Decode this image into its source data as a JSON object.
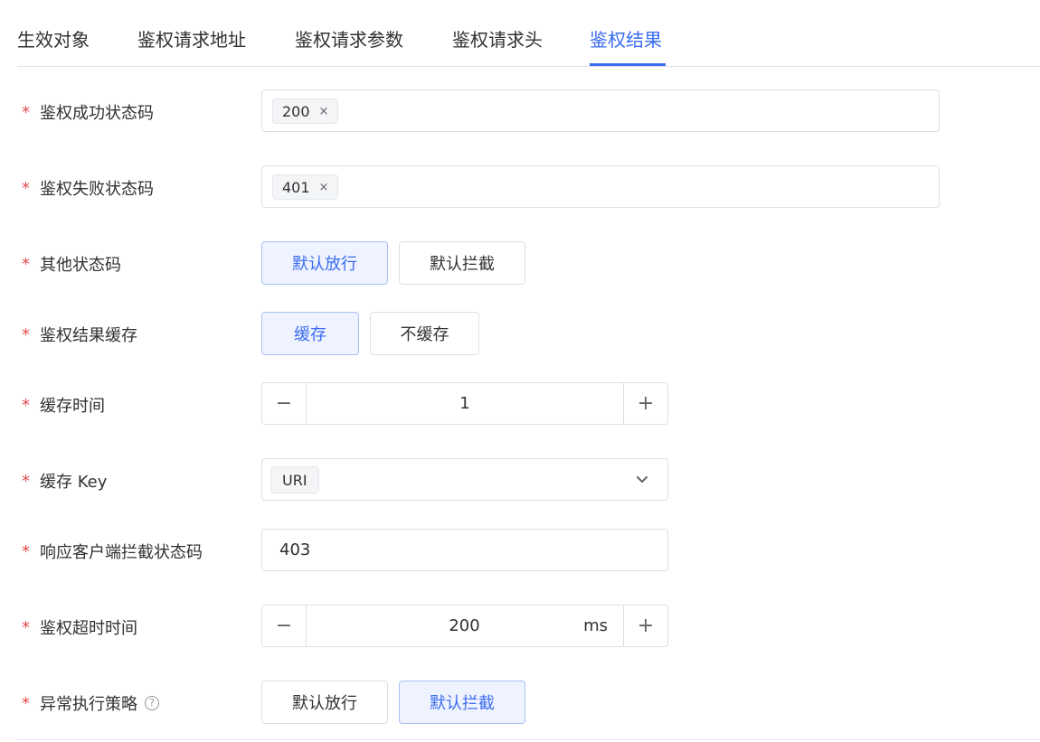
{
  "tabs": [
    {
      "label": "生效对象",
      "active": false
    },
    {
      "label": "鉴权请求地址",
      "active": false
    },
    {
      "label": "鉴权请求参数",
      "active": false
    },
    {
      "label": "鉴权请求头",
      "active": false
    },
    {
      "label": "鉴权结果",
      "active": true
    }
  ],
  "form": {
    "required_mark": "*",
    "success_codes": {
      "label": "鉴权成功状态码",
      "tags": [
        "200"
      ],
      "remove_icon": "close-icon",
      "remove_glyph": "×"
    },
    "fail_codes": {
      "label": "鉴权失败状态码",
      "tags": [
        "401"
      ],
      "remove_icon": "close-icon",
      "remove_glyph": "×"
    },
    "other_codes": {
      "label": "其他状态码",
      "options": [
        "默认放行",
        "默认拦截"
      ],
      "selected": "默认放行"
    },
    "result_cache": {
      "label": "鉴权结果缓存",
      "options": [
        "缓存",
        "不缓存"
      ],
      "selected": "缓存"
    },
    "cache_time": {
      "label": "缓存时间",
      "value": "1",
      "minus": "−",
      "plus": "+"
    },
    "cache_key": {
      "label": "缓存 Key",
      "selected_tag": "URI",
      "dropdown_icon": "chevron-down-icon"
    },
    "intercept_code": {
      "label": "响应客户端拦截状态码",
      "value": "403"
    },
    "timeout": {
      "label": "鉴权超时时间",
      "value": "200",
      "unit": "ms",
      "minus": "−",
      "plus": "+"
    },
    "exception_policy": {
      "label": "异常执行策略",
      "help_icon": "question-circle-icon",
      "help_glyph": "?",
      "options": [
        "默认放行",
        "默认拦截"
      ],
      "selected": "默认拦截"
    }
  },
  "colors": {
    "accent": "#3b6cf0",
    "required": "#e5484d",
    "border": "#dcdfe6",
    "selected_bg": "#eef3ff"
  }
}
